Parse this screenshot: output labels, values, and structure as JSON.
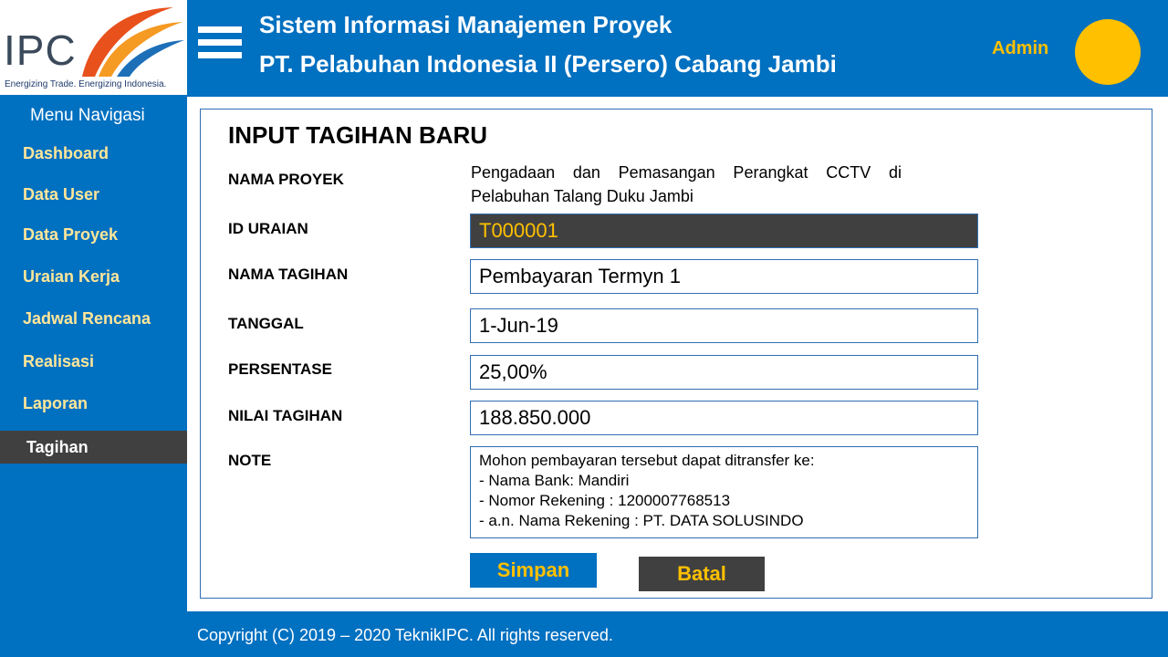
{
  "brand": {
    "logo_text": "IPC",
    "tagline": "Energizing Trade. Energizing Indonesia."
  },
  "header": {
    "title_line1": "Sistem Informasi Manajemen Proyek",
    "title_line2": "PT. Pelabuhan Indonesia II (Persero) Cabang Jambi",
    "user": "Admin",
    "menu_icon": "hamburger-menu-icon"
  },
  "sidebar": {
    "title": "Menu Navigasi",
    "items": [
      {
        "label": "Dashboard",
        "active": false
      },
      {
        "label": "Data User",
        "active": false
      },
      {
        "label": "Data Proyek",
        "active": false
      },
      {
        "label": "Uraian Kerja",
        "active": false
      },
      {
        "label": "Jadwal Rencana",
        "active": false
      },
      {
        "label": "Realisasi",
        "active": false
      },
      {
        "label": "Laporan",
        "active": false
      },
      {
        "label": "Tagihan",
        "active": true
      }
    ]
  },
  "form": {
    "title": "INPUT TAGIHAN BARU",
    "nama_proyek": {
      "label": "NAMA PROYEK",
      "value": "Pengadaan dan Pemasangan Perangkat CCTV di Pelabuhan Talang Duku Jambi"
    },
    "id_uraian": {
      "label": "ID URAIAN",
      "value": "T000001"
    },
    "nama_tagihan": {
      "label": "NAMA TAGIHAN",
      "value": "Pembayaran Termyn 1"
    },
    "tanggal": {
      "label": "TANGGAL",
      "value": "1-Jun-19"
    },
    "persentase": {
      "label": "PERSENTASE",
      "value": "25,00%"
    },
    "nilai_tagihan": {
      "label": "NILAI TAGIHAN",
      "value": "188.850.000"
    },
    "note": {
      "label": "NOTE",
      "lines": [
        "Mohon pembayaran tersebut dapat ditransfer ke:",
        "- Nama Bank: Mandiri",
        "- Nomor Rekening : 1200007768513",
        "- a.n. Nama Rekening : PT. DATA SOLUSINDO"
      ]
    },
    "save_label": "Simpan",
    "cancel_label": "Batal"
  },
  "footer": {
    "text": "Copyright (C) 2019 – 2020 TeknikIPC. All rights reserved."
  },
  "colors": {
    "primary_blue": "#0070c0",
    "accent_yellow": "#ffc000",
    "nav_text": "#ffe699",
    "dark_gray": "#404040"
  }
}
